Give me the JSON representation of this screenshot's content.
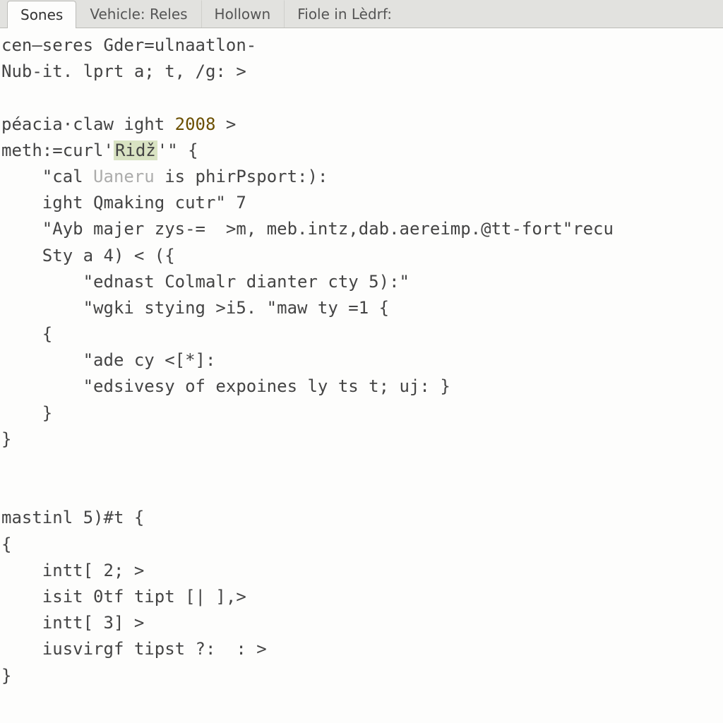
{
  "tabs": [
    {
      "label": "Sones",
      "active": true
    },
    {
      "label": "Vehicle: Reles",
      "active": false
    },
    {
      "label": "Hollown",
      "active": false
    },
    {
      "label": "Fiole in Lèdrf:",
      "active": false
    }
  ],
  "code": {
    "l01": "cen—seres Gder=ulnaatlon-",
    "l02": "Nub-it. lprt a; t, /g: >",
    "l03": "",
    "l04a": "péacia·claw ight ",
    "l04b": "2008",
    "l04c": " >",
    "l05a": "meth:=curl'",
    "l05b": "Ridž",
    "l05c": "'\" {",
    "l06a": "    \"cal ",
    "l06b": "Uaneru",
    "l06c": " is phirPsport:):",
    "l07": "    ight Qmaking cutr\" 7",
    "l08": "    \"Ayb majer zys-=  >m, meb.intz,dab.aereimp.@tt-fort\"recu",
    "l09": "    Sty a 4) < ({",
    "l10": "        \"ednast Colmalr dianter cty 5):\"",
    "l11": "        \"wgki stying >i5. \"maw ty =1 {",
    "l12": "    {",
    "l13": "        \"ade cy <[*]:",
    "l14": "        \"edsivesy of expoines ly ts t; uj: }",
    "l15": "    }",
    "l16": "}",
    "l17": "",
    "l18": "",
    "l19": "mastinl 5)#t {",
    "l20": "{",
    "l21": "    intt[ 2; >",
    "l22": "    isit 0tf tipt [| ],>",
    "l23": "    intt[ 3] >",
    "l24": "    iusvirgf tipst ?:  : >",
    "l25": "}"
  }
}
